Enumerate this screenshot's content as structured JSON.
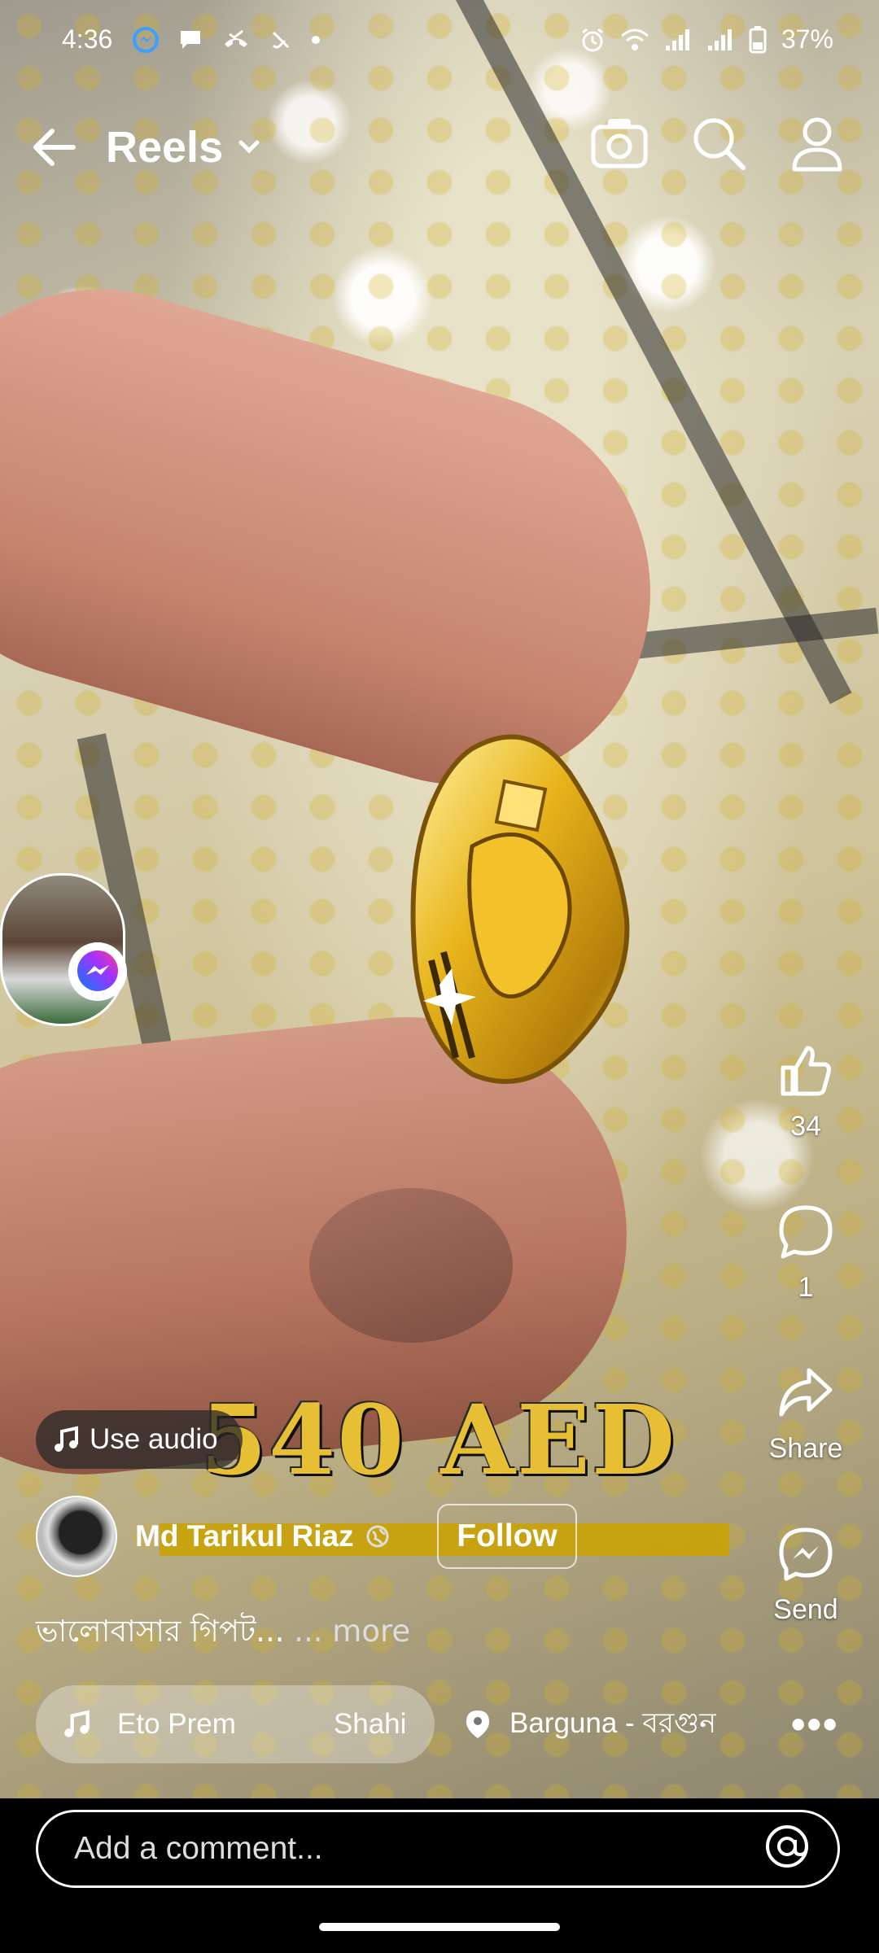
{
  "status_bar": {
    "time": "4:36",
    "battery": "37%"
  },
  "header": {
    "title": "Reels"
  },
  "side_actions": {
    "like_count": "34",
    "comment_count": "1",
    "share_label": "Share",
    "send_label": "Send"
  },
  "video_overlay_text": "540 AED",
  "use_audio_label": "Use audio",
  "author": {
    "name": "Md Tarikul Riaz",
    "follow_label": "Follow"
  },
  "caption": {
    "text": "ভালোবাসার গিপট...",
    "more": "... more"
  },
  "music_chip": {
    "song": "Eto Prem",
    "artist": "Shahi"
  },
  "location_chip": {
    "label": "Barguna - বরগুন"
  },
  "comment_box": {
    "placeholder": "Add a comment..."
  },
  "colors": {
    "price_gold": "#e7bf35",
    "messenger_start": "#0a7cff",
    "messenger_end": "#ff3b8a"
  }
}
